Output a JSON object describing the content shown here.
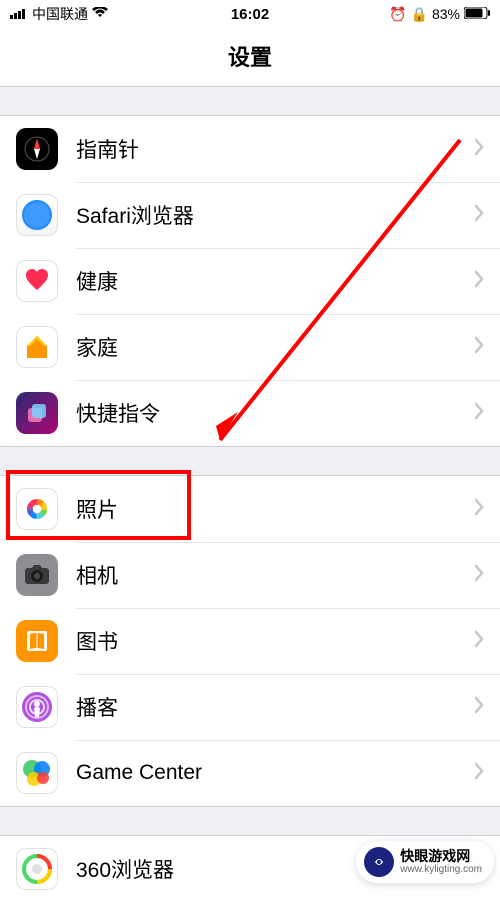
{
  "status": {
    "signal_label": "􀙇",
    "carrier": "中国联通",
    "time": "16:02",
    "battery_pct": "83%"
  },
  "header": {
    "title": "设置"
  },
  "group1": [
    {
      "name": "compass",
      "label": "指南针"
    },
    {
      "name": "safari",
      "label": "Safari浏览器"
    },
    {
      "name": "health",
      "label": "健康"
    },
    {
      "name": "home",
      "label": "家庭"
    },
    {
      "name": "shortcuts",
      "label": "快捷指令"
    }
  ],
  "group2": [
    {
      "name": "photos",
      "label": "照片"
    },
    {
      "name": "camera",
      "label": "相机"
    },
    {
      "name": "books",
      "label": "图书"
    },
    {
      "name": "podcasts",
      "label": "播客"
    },
    {
      "name": "game-center",
      "label": "Game Center"
    }
  ],
  "group3": [
    {
      "name": "browser-360",
      "label": "360浏览器"
    }
  ],
  "watermark": {
    "title": "快眼游戏网",
    "url": "www.kyligting.com"
  }
}
